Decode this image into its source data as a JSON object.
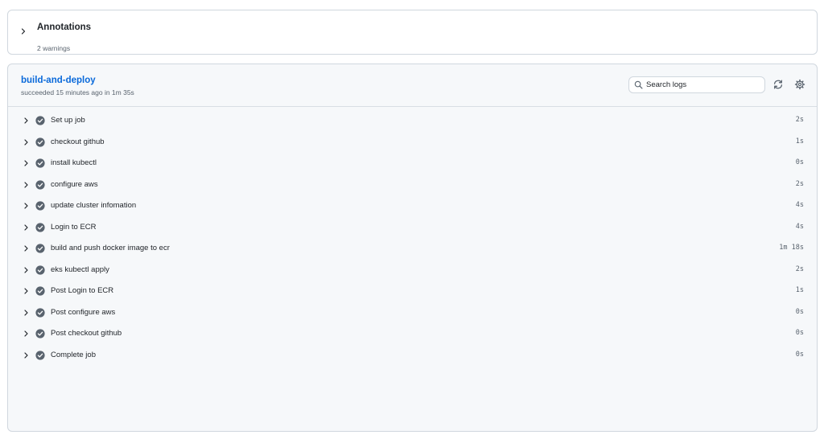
{
  "annotations": {
    "title": "Annotations",
    "subtitle": "2 warnings"
  },
  "job": {
    "name": "build-and-deploy",
    "status": "succeeded 15 minutes ago in 1m 35s",
    "search": {
      "placeholder": "Search logs",
      "value": ""
    },
    "steps": [
      {
        "name": "Set up job",
        "duration": "2s"
      },
      {
        "name": "checkout github",
        "duration": "1s"
      },
      {
        "name": "install kubectl",
        "duration": "0s"
      },
      {
        "name": "configure aws",
        "duration": "2s"
      },
      {
        "name": "update cluster infomation",
        "duration": "4s"
      },
      {
        "name": "Login to ECR",
        "duration": "4s"
      },
      {
        "name": "build and push docker image to ecr",
        "duration": "1m 18s"
      },
      {
        "name": "eks kubectl apply",
        "duration": "2s"
      },
      {
        "name": "Post Login to ECR",
        "duration": "1s"
      },
      {
        "name": "Post configure aws",
        "duration": "0s"
      },
      {
        "name": "Post checkout github",
        "duration": "0s"
      },
      {
        "name": "Complete job",
        "duration": "0s"
      }
    ]
  },
  "colors": {
    "link": "#0969da",
    "success_icon": "#59636e",
    "border": "#d0d7de",
    "panel_bg": "#f6f8fa"
  },
  "icons": {
    "expand": "chevron-right-icon",
    "step_status": "check-circle-fill-icon",
    "search": "search-icon",
    "refresh": "sync-icon",
    "settings": "gear-icon"
  }
}
